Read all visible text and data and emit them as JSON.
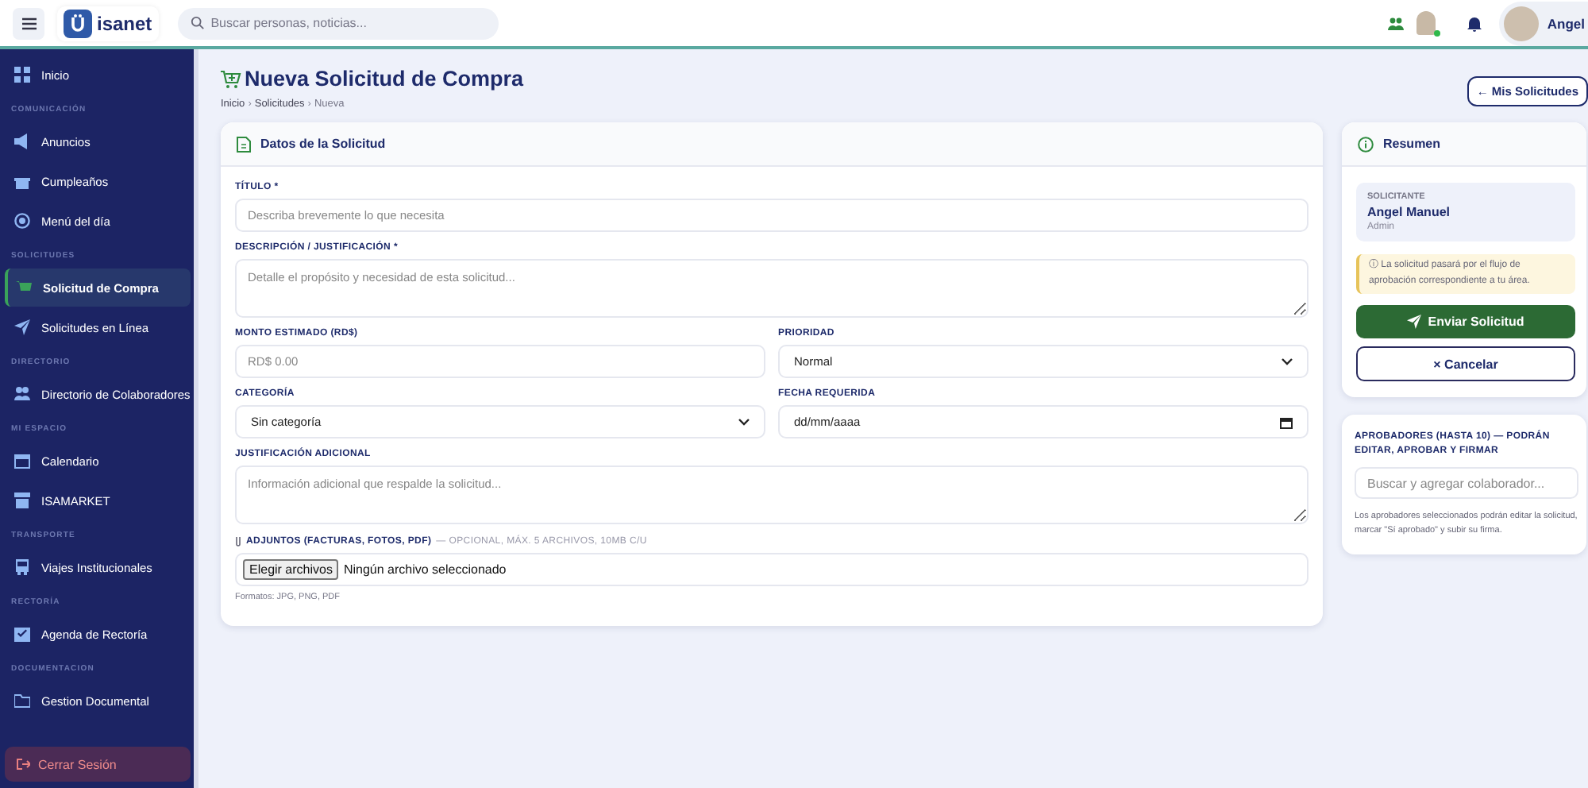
{
  "topbar": {
    "logo": "isanet",
    "search": {
      "placeholder": "Buscar personas, noticias..."
    },
    "user": {
      "name": "Angel",
      "online": true
    }
  },
  "sidebar": {
    "sections": [
      {
        "items": [
          {
            "label": "Inicio",
            "selected": false
          }
        ]
      },
      {
        "header": "COMUNICACIÓN",
        "items": [
          {
            "label": "Anuncios",
            "selected": false
          },
          {
            "label": "Cumpleaños",
            "selected": false
          },
          {
            "label": "Menú del día",
            "selected": false
          }
        ]
      },
      {
        "header": "SOLICITUDES",
        "items": [
          {
            "label": "Solicitud de Compra",
            "selected": true
          },
          {
            "label": "Solicitudes en Línea",
            "selected": false
          }
        ]
      },
      {
        "header": "DIRECTORIO",
        "items": [
          {
            "label": "Directorio de Colaboradores",
            "selected": false
          }
        ]
      },
      {
        "header": "MI ESPACIO",
        "items": [
          {
            "label": "Calendario",
            "selected": false
          },
          {
            "label": "ISAMARKET",
            "selected": false
          }
        ]
      },
      {
        "header": "TRANSPORTE",
        "items": [
          {
            "label": "Viajes Institucionales",
            "selected": false
          }
        ]
      },
      {
        "header": "RECTORÍA",
        "items": [
          {
            "label": "Agenda de Rectoría",
            "selected": false
          }
        ]
      },
      {
        "header": "DOCUMENTACION",
        "items": [
          {
            "label": "Gestion Documental",
            "selected": false
          }
        ]
      }
    ],
    "logout": "Cerrar Sesión"
  },
  "page": {
    "title": "Nueva Solicitud de Compra",
    "breadcrumb": [
      {
        "label": "Inicio"
      },
      {
        "separator": "›",
        "label": "Solicitudes"
      },
      {
        "separator": "›",
        "label": "Nueva"
      }
    ],
    "back_button": "← Mis Solicitudes"
  },
  "form": {
    "title": "Datos de la Solicitud",
    "rows": [
      [
        {
          "kind": "input",
          "label": "TÍTULO *",
          "placeholder": "Describa brevemente lo que necesita"
        }
      ],
      [
        {
          "kind": "textarea",
          "label": "DESCRIPCIÓN / JUSTIFICACIÓN *",
          "placeholder": "Detalle el propósito y necesidad de esta solicitud..."
        }
      ],
      [
        {
          "kind": "input",
          "label": "MONTO ESTIMADO (RD$)",
          "placeholder": "RD$ 0.00"
        },
        {
          "kind": "select",
          "label": "PRIORIDAD",
          "value": "Normal"
        }
      ],
      [
        {
          "kind": "select",
          "label": "CATEGORÍA",
          "value": "Sin categoría"
        },
        {
          "kind": "date",
          "label": "FECHA REQUERIDA",
          "value": "dd/mm/aaaa"
        }
      ],
      [
        {
          "kind": "textarea",
          "label": "JUSTIFICACIÓN ADICIONAL",
          "placeholder": "Información adicional que respalde la solicitud..."
        }
      ],
      [
        {
          "kind": "file",
          "label": "ADJUNTOS (FACTURAS, FOTOS, PDF)",
          "note": "— OPCIONAL, MÁX. 5 ARCHIVOS, 10MB C/U",
          "button": "Elegir archivos",
          "value": "Ningún archivo seleccionado",
          "hint": "Formatos: JPG, PNG, PDF"
        }
      ]
    ]
  },
  "summary": {
    "title": "Resumen",
    "requester_label": "SOLICITANTE",
    "requester_name": "Angel Manuel",
    "requester_role": "Admin",
    "notice": "ⓘ La solicitud pasará por el flujo de aprobación correspondiente a tu área.",
    "submit": "Enviar Solicitud",
    "cancel": "× Cancelar"
  },
  "approvers": {
    "title": "APROBADORES (HASTA 10) — PODRÁN EDITAR, APROBAR Y FIRMAR",
    "placeholder": "Buscar y agregar colaborador...",
    "help": "Los aprobadores seleccionados podrán editar la solicitud, marcar \"Sí aprobado\" y subir su firma."
  }
}
